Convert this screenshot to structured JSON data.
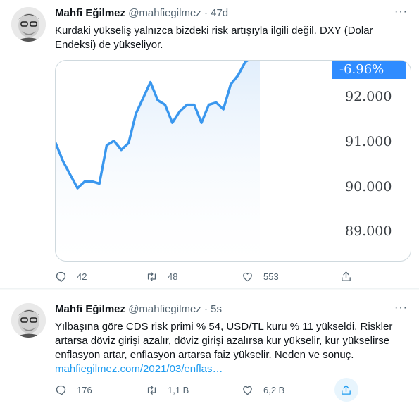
{
  "tweets": [
    {
      "name": "Mahfi Eğilmez",
      "handle": "@mahfiegilmez",
      "separator": "·",
      "time": "47d",
      "text": "Kurdaki yükseliş yalnızca bizdeki risk artışıyla ilgili değil. DXY (Dolar Endeksi) de yükseliyor.",
      "replies": "42",
      "retweets": "48",
      "likes": "553"
    },
    {
      "name": "Mahfi Eğilmez",
      "handle": "@mahfiegilmez",
      "separator": "·",
      "time": "5s",
      "text": "Yılbaşına göre CDS risk primi % 54, USD/TL kuru % 11 yükseldi. Riskler artarsa döviz girişi azalır, döviz girişi azalırsa kur yükselir, kur yükselirse enflasyon artar, enflasyon artarsa faiz yükselir. Neden ve sonuç.",
      "link": "mahfiegilmez.com/2021/03/enflas…",
      "replies": "176",
      "retweets": "1,1 B",
      "likes": "6,2 B"
    }
  ],
  "icons": {
    "more": "more-icon",
    "reply": "reply-icon",
    "retweet": "retweet-icon",
    "like": "like-icon",
    "share": "share-icon"
  },
  "colors": {
    "accent": "#1d9bf0",
    "line": "#3a97ee",
    "badge": "#2f8cff",
    "muted": "#536471"
  },
  "chart_data": {
    "type": "line",
    "badge_label": "-6.96%",
    "tick_labels": [
      "92.000",
      "91.000",
      "90.000",
      "89.000"
    ],
    "yticks": [
      92,
      91,
      90,
      89
    ],
    "ylim": [
      88.2,
      93.2
    ],
    "grid": false,
    "series": [
      {
        "values": [
          91.0,
          90.6,
          90.3,
          90.0,
          90.15,
          90.15,
          90.1,
          90.95,
          91.05,
          90.85,
          91.0,
          91.65,
          92.0,
          92.35,
          91.95,
          91.85,
          91.45,
          91.7,
          91.85,
          91.85,
          91.45,
          91.85,
          91.9,
          91.75,
          92.3,
          92.5,
          92.8,
          92.9,
          93.1
        ]
      }
    ]
  }
}
